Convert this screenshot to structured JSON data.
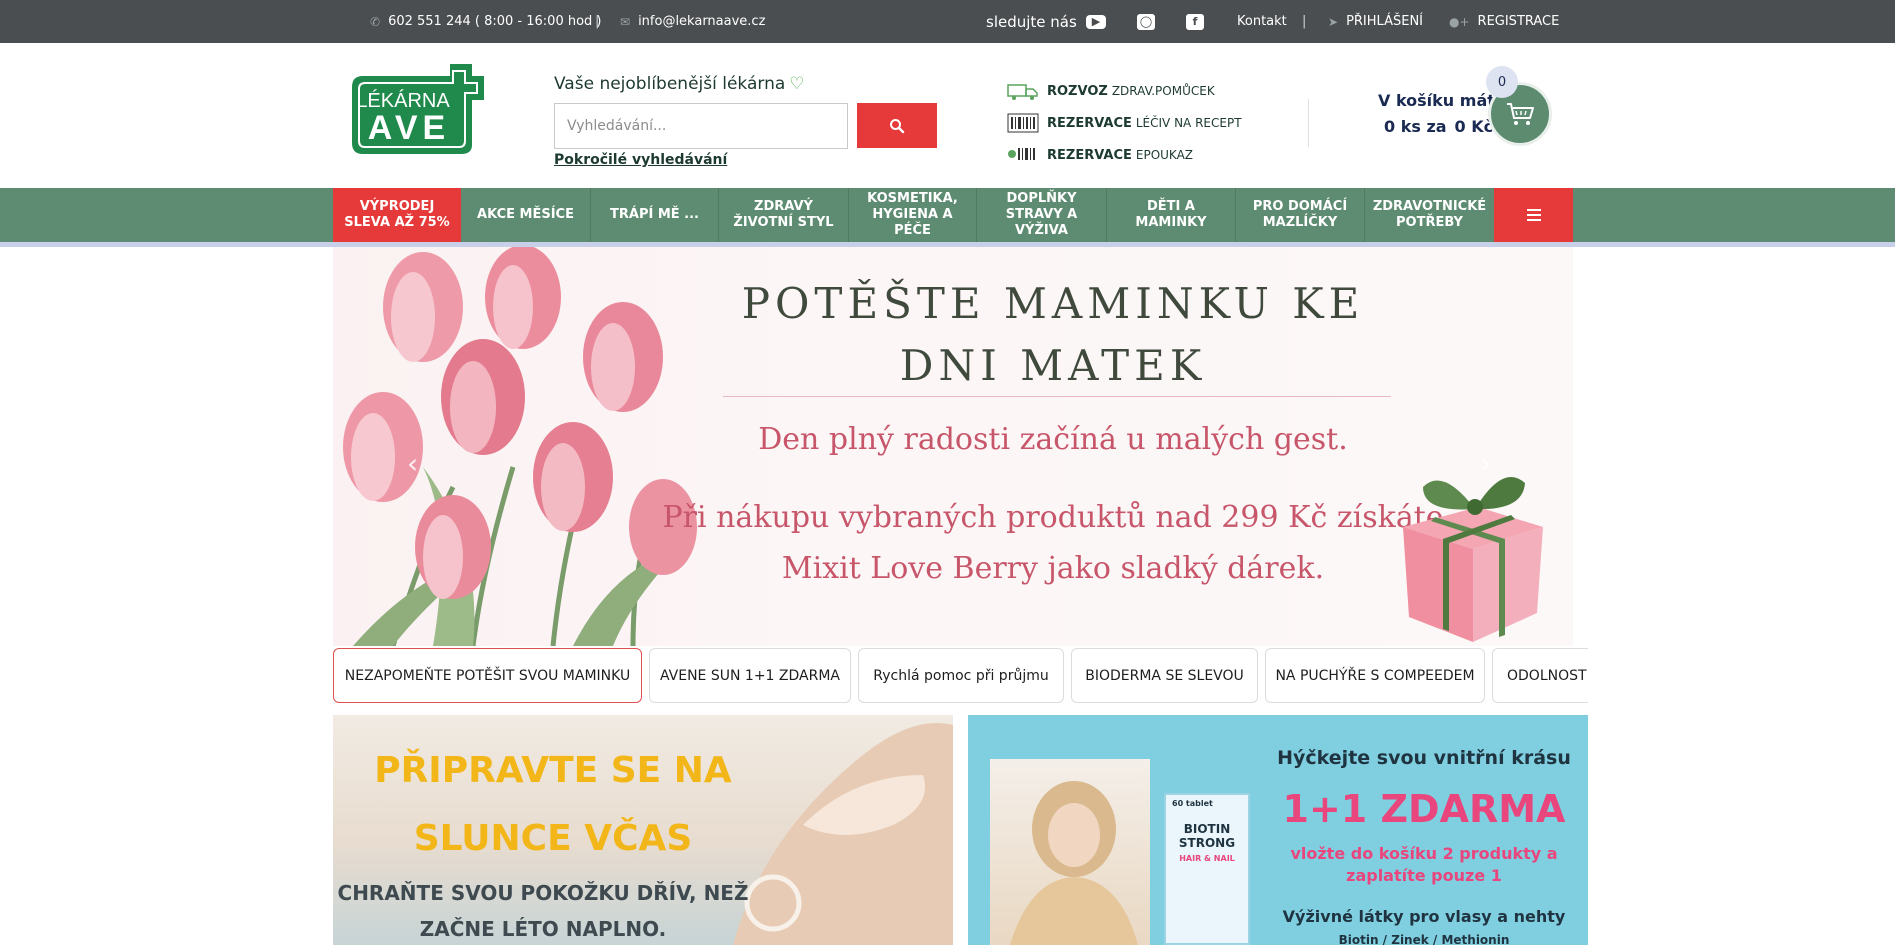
{
  "topbar": {
    "phone": "602 551 244 ( 8:00 - 16:00 hod )",
    "separator": "|",
    "email": "info@lekarnaave.cz",
    "follow": "sledujte nás",
    "contact": "Kontakt",
    "login": "PŘIHLÁŠENÍ",
    "register": "REGISTRACE",
    "icons": [
      "phone-icon",
      "mail-icon",
      "youtube-icon",
      "instagram-icon",
      "facebook-icon",
      "login-icon",
      "user-plus-icon"
    ]
  },
  "header": {
    "logo_top": "LÉKÁRNA",
    "logo_bottom": "AVE",
    "tagline": "Vaše nejoblíbenější lékárna",
    "search_placeholder": "Vyhledávání...",
    "advanced_search": "Pokročilé vyhledávání",
    "services": [
      {
        "main": "ROZVOZ",
        "sub": "ZDRAV.POMŮCEK",
        "icon": "truck-icon"
      },
      {
        "main": "REZERVACE",
        "sub": "LÉČIV NA RECEPT",
        "icon": "barcode-icon"
      },
      {
        "main": "REZERVACE",
        "sub": "EPOUKAZ",
        "icon": "epoukaz-icon"
      }
    ],
    "cart": {
      "label": "V košíku máte",
      "count_text": "0 ks za",
      "price_text": "0 Kč",
      "badge": "0"
    }
  },
  "nav": {
    "items": [
      "VÝPRODEJ SLEVA AŽ 75%",
      "AKCE MĚSÍCE",
      "TRÁPÍ MĚ ...",
      "ZDRAVÝ ŽIVOTNÍ STYL",
      "KOSMETIKA, HYGIENA A PÉČE",
      "DOPLŇKY STRAVY A VÝŽIVA",
      "DĚTI A MAMINKY",
      "PRO DOMÁCÍ MAZLÍČKY",
      "ZDRAVOTNICKÉ POTŘEBY"
    ]
  },
  "banner": {
    "title": "POTĚŠTE MAMINKU KE DNI MATEK",
    "subtitle": "Den plný radosti začíná u malých gest.",
    "text": "Při nákupu vybraných produktů nad 299 Kč získáte Mixit Love Berry jako sladký dárek."
  },
  "tabs": [
    "NEZAPOMEŇTE POTĚŠIT SVOU MAMINKU",
    "AVENE SUN 1+1 ZDARMA",
    "Rychlá pomoc při průjmu",
    "BIODERMA SE SLEVOU",
    "NA PUCHÝŘE S COMPEEDEM",
    "ODOLNOST"
  ],
  "promos": {
    "left": {
      "title": "PŘIPRAVTE SE NA SLUNCE VČAS",
      "subtitle": "CHRAŇTE SVOU POKOŽKU DŘÍV, NEŽ ZAČNE LÉTO NAPLNO."
    },
    "right": {
      "heading": "Hýčkejte svou vnitřní krásu",
      "big": "1+1 ZDARMA",
      "pink": "vložte do košíku 2 produkty a zaplatíte pouze 1",
      "dark": "Výživné látky pro vlasy a nehty",
      "small": "Biotin / Zinek / Methionin",
      "product_brand": "BIOTIN STRONG",
      "product_sub": "HAIR & NAIL",
      "product_count": "60 tablet"
    }
  },
  "colors": {
    "topbar": "#4a4e50",
    "nav": "#5e8c72",
    "accent_red": "#e63a3a",
    "dark_green": "#1d3a2f",
    "cart_blue": "#1a2a52",
    "banner_pink": "#c8566a"
  }
}
